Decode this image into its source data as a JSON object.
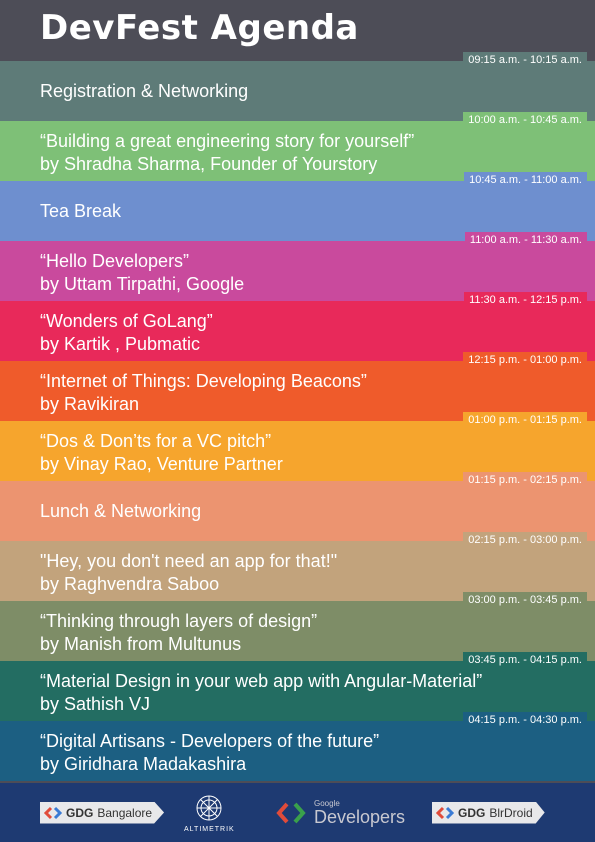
{
  "title": "DevFest  Agenda",
  "sessions": [
    {
      "line1": "Registration & Networking",
      "line2": "",
      "time": "09:15 a.m. - 10:15 a.m.",
      "color": "#5e7b78"
    },
    {
      "line1": "“Building a great engineering story for yourself”",
      "line2": "by Shradha Sharma, Founder of Yourstory",
      "time": "10:00 a.m. - 10:45 a.m.",
      "color": "#7ec077"
    },
    {
      "line1": "Tea Break",
      "line2": "",
      "time": "10:45 a.m. - 11:00 a.m.",
      "color": "#6e8fcf"
    },
    {
      "line1": "“Hello Developers”",
      "line2": "by Uttam Tirpathi, Google",
      "time": "11:00 a.m. - 11:30 a.m.",
      "color": "#c94a9d"
    },
    {
      "line1": "“Wonders of GoLang”",
      "line2": "by Kartik , Pubmatic",
      "time": "11:30 a.m. - 12:15 p.m.",
      "color": "#e8295a"
    },
    {
      "line1": "“Internet of Things: Developing Beacons”",
      "line2": " by Ravikiran",
      "time": "12:15 p.m. - 01:00 p.m.",
      "color": "#ef5b2b"
    },
    {
      "line1": "“Dos & Don’ts for a VC pitch”",
      "line2": "by Vinay Rao, Venture Partner",
      "time": "01:00 p.m. - 01:15 p.m.",
      "color": "#f6a52d"
    },
    {
      "line1": "Lunch & Networking",
      "line2": "",
      "time": "01:15 p.m. - 02:15 p.m.",
      "color": "#ec9470"
    },
    {
      "line1": "\"Hey, you don't need an app for that!\"",
      "line2": "by Raghvendra Saboo",
      "time": "02:15 p.m. - 03:00 p.m.",
      "color": "#c2a37c"
    },
    {
      "line1": "“Thinking through layers of design”",
      "line2": "by Manish from Multunus",
      "time": "03:00 p.m. - 03:45 p.m.",
      "color": "#7e8d67"
    },
    {
      "line1": "“Material Design in your web app with Angular-Material”",
      "line2": "by Sathish VJ",
      "time": "03:45 p.m. - 04:15 p.m.",
      "color": "#236d62"
    },
    {
      "line1": "“Digital Artisans - Developers of the future”",
      "line2": "by Giridhara Madakashira",
      "time": "04:15 p.m. - 04:30 p.m.",
      "color": "#1c5f82"
    }
  ],
  "footer": {
    "gdg_bangalore": {
      "prefix": "GDG",
      "name": "Bangalore"
    },
    "altimetrik": "ALTIMETRIK",
    "google_developers": {
      "small": "Google",
      "big": "Developers"
    },
    "gdg_blrdroid": {
      "prefix": "GDG",
      "name": "BlrDroid"
    }
  }
}
